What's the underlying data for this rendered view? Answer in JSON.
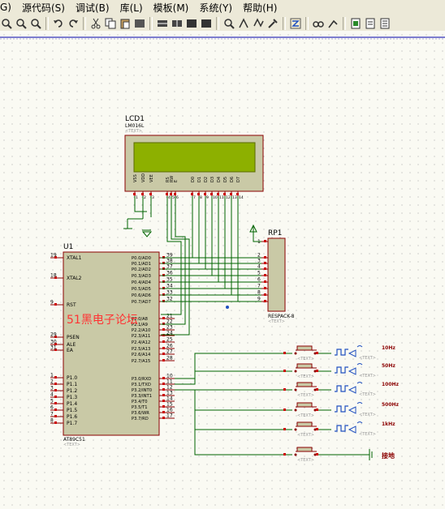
{
  "menu": {
    "items": [
      "G)",
      "源代码(S)",
      "调试(B)",
      "库(L)",
      "模板(M)",
      "系统(Y)",
      "帮助(H)"
    ]
  },
  "toolbar": {
    "icons": [
      "zoom-in-icon",
      "zoom-out-icon",
      "zoom-area-icon",
      "undo-icon",
      "redo-icon",
      "cut-icon",
      "copy-icon",
      "paste-icon",
      "block-copy-icon",
      "block-move-icon",
      "block-rotate-icon",
      "block-delete-icon",
      "pick-device-icon",
      "make-device-icon",
      "packaging-tool-icon",
      "decompose-icon",
      "wire-autoroute-icon",
      "search-tag-icon",
      "property-tool-icon",
      "design-explorer-icon",
      "new-sheet-icon",
      "delete-sheet-icon",
      "bill-of-materials-icon"
    ]
  },
  "schematic": {
    "lcd": {
      "ref": "LCD1",
      "part": "LM016L",
      "text": "<TEXT>",
      "pins": [
        "VSS",
        "VDD",
        "VEE",
        "RS",
        "RW",
        "E",
        "D0",
        "D1",
        "D2",
        "D3",
        "D4",
        "D5",
        "D6",
        "D7"
      ],
      "pin_nums": [
        "1",
        "2",
        "3",
        "4",
        "5",
        "6",
        "7",
        "8",
        "9",
        "10",
        "11",
        "12",
        "13",
        "14"
      ]
    },
    "mcu": {
      "ref": "U1",
      "part": "AT89C51",
      "text": "<TEXT>",
      "left_pins": [
        {
          "num": "19",
          "name": "XTAL1"
        },
        {
          "num": "18",
          "name": "XTAL2"
        },
        {
          "num": "9",
          "name": "RST"
        },
        {
          "num": "29",
          "name": "PSEN"
        },
        {
          "num": "30",
          "name": "ALE"
        },
        {
          "num": "31",
          "name": "EA"
        },
        {
          "num": "1",
          "name": "P1.0"
        },
        {
          "num": "2",
          "name": "P1.1"
        },
        {
          "num": "3",
          "name": "P1.2"
        },
        {
          "num": "4",
          "name": "P1.3"
        },
        {
          "num": "5",
          "name": "P1.4"
        },
        {
          "num": "6",
          "name": "P1.5"
        },
        {
          "num": "7",
          "name": "P1.6"
        },
        {
          "num": "8",
          "name": "P1.7"
        }
      ],
      "right_pins": [
        {
          "num": "39",
          "name": "P0.0/AD0"
        },
        {
          "num": "38",
          "name": "P0.1/AD1"
        },
        {
          "num": "37",
          "name": "P0.2/AD2"
        },
        {
          "num": "36",
          "name": "P0.3/AD3"
        },
        {
          "num": "35",
          "name": "P0.4/AD4"
        },
        {
          "num": "34",
          "name": "P0.5/AD5"
        },
        {
          "num": "33",
          "name": "P0.6/AD6"
        },
        {
          "num": "32",
          "name": "P0.7/AD7"
        },
        {
          "num": "21",
          "name": "P2.0/A8"
        },
        {
          "num": "22",
          "name": "P2.1/A9"
        },
        {
          "num": "23",
          "name": "P2.2/A10"
        },
        {
          "num": "24",
          "name": "P2.3/A11"
        },
        {
          "num": "25",
          "name": "P2.4/A12"
        },
        {
          "num": "26",
          "name": "P2.5/A13"
        },
        {
          "num": "27",
          "name": "P2.6/A14"
        },
        {
          "num": "28",
          "name": "P2.7/A15"
        },
        {
          "num": "10",
          "name": "P3.0/RXD"
        },
        {
          "num": "11",
          "name": "P3.1/TXD"
        },
        {
          "num": "12",
          "name": "P3.2/INT0"
        },
        {
          "num": "13",
          "name": "P3.3/INT1"
        },
        {
          "num": "14",
          "name": "P3.4/T0"
        },
        {
          "num": "15",
          "name": "P3.5/T1"
        },
        {
          "num": "16",
          "name": "P3.6/WR"
        },
        {
          "num": "17",
          "name": "P3.7/RD"
        }
      ]
    },
    "rp": {
      "ref": "RP1",
      "part": "RESPACK-8",
      "text": "<TEXT>",
      "pins": [
        "2",
        "3",
        "4",
        "5",
        "6",
        "7",
        "8",
        "9"
      ],
      "pin1": "1"
    },
    "watermark": "51黑电子论坛",
    "gen_labels": [
      "10Hz",
      "50Hz",
      "100Hz",
      "500Hz",
      "1kHz"
    ],
    "gen_text": "<TEXT>",
    "ground_label": "接地"
  },
  "colors": {
    "wire": "#006400",
    "component_fill": "#c9c9a6",
    "component_stroke": "#8b0000",
    "pin_red": "#cc0000",
    "lcd_screen": "#8db000",
    "label_dark": "#000080",
    "watermark": "#ff3333"
  }
}
